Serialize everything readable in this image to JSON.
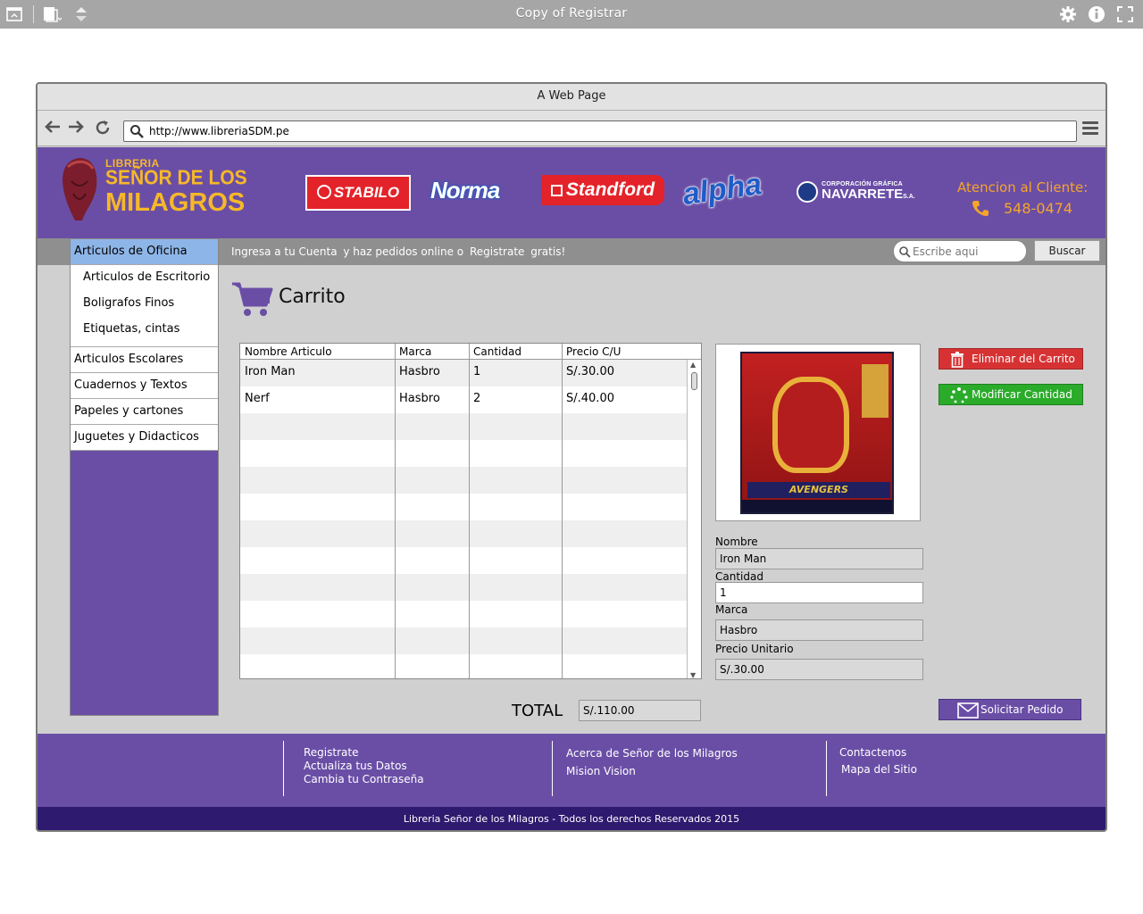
{
  "app": {
    "title": "Copy of Registrar"
  },
  "browser": {
    "page_title": "A Web Page",
    "url": "http://www.libreriaSDM.pe"
  },
  "header": {
    "logo_line1": "LIBRERIA",
    "logo_line2": "SEÑOR DE LOS",
    "logo_line3": "MILAGROS",
    "brands": {
      "stabilo": "STABILO",
      "norma": "Norma",
      "standford": "Standford",
      "alpha": "alpha",
      "navarrete_top": "CORPORACIÓN GRÁFICA",
      "navarrete_name": "NAVARRETE",
      "navarrete_suffix": "S.A."
    },
    "attention_label": "Atencion al Cliente:",
    "attention_phone": "548-0474"
  },
  "strip": {
    "link_account": "Ingresa a tu Cuenta",
    "middle_text": "y haz pedidos online o",
    "link_register": "Registrate",
    "end_text": "gratis!",
    "search_placeholder": "Escribe aqui",
    "search_button": "Buscar"
  },
  "sidebar": {
    "items": [
      {
        "label": "Articulos de Oficina",
        "selected": true
      },
      {
        "label": "Articulos de Escritorio",
        "sub": true
      },
      {
        "label": "Boligrafos Finos",
        "sub": true
      },
      {
        "label": "Etiquetas, cintas",
        "sub": true
      },
      {
        "label": "Articulos Escolares"
      },
      {
        "label": "Cuadernos y Textos"
      },
      {
        "label": "Papeles y cartones"
      },
      {
        "label": "Juguetes y Didacticos"
      }
    ]
  },
  "cart": {
    "title": "Carrito",
    "columns": [
      "Nombre Articulo",
      "Marca",
      "Cantidad",
      "Precio C/U"
    ],
    "rows": [
      [
        "Iron Man",
        "Hasbro",
        "1",
        "S/.30.00"
      ],
      [
        "Nerf",
        "Hasbro",
        "2",
        "S/.40.00"
      ]
    ],
    "total_label": "TOTAL",
    "total_value": "S/.110.00"
  },
  "product": {
    "image_label": "AVENGERS",
    "name_label": "Nombre",
    "name_value": "Iron Man",
    "qty_label": "Cantidad",
    "qty_value": "1",
    "brand_label": "Marca",
    "brand_value": "Hasbro",
    "price_label": "Precio Unitario",
    "price_value": "S/.30.00"
  },
  "actions": {
    "delete": "Eliminar del Carrito",
    "modify": "Modificar Cantidad",
    "order": "Solicitar Pedido"
  },
  "footer": {
    "col1": [
      "Registrate",
      "Actualiza tus Datos",
      "Cambia tu Contraseña"
    ],
    "col2": [
      "Acerca de Señor de los Milagros",
      "Mision Vision"
    ],
    "col3": [
      "Contactenos",
      "Mapa del Sitio"
    ],
    "copyright": "Libreria Señor de los Milagros - Todos los derechos Reservados 2015"
  },
  "colors": {
    "purple": "#6a4ea6",
    "dark_purple": "#2e1a6e",
    "orange": "#f6a52a",
    "red": "#d73233",
    "green": "#2aab2a"
  }
}
